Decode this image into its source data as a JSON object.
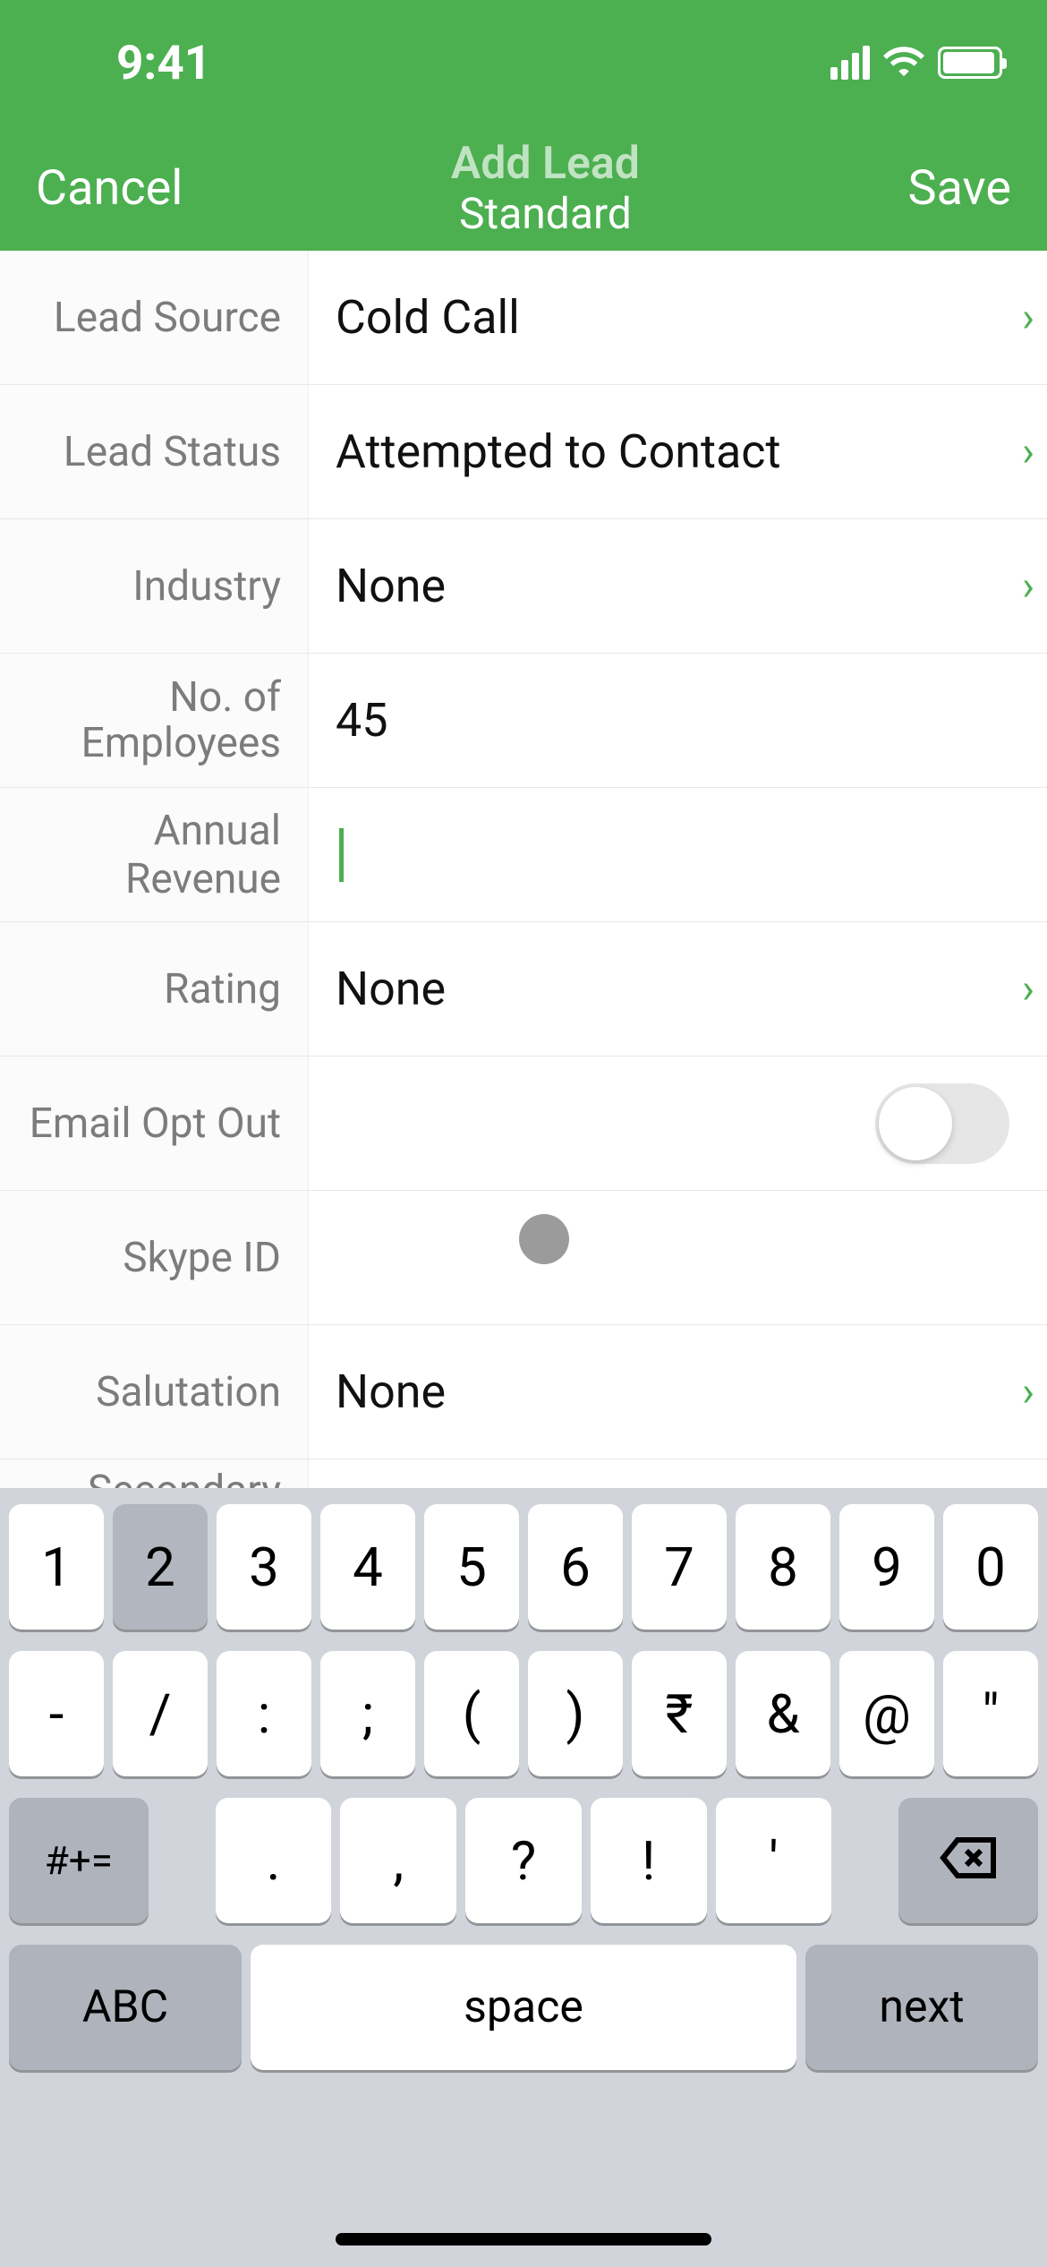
{
  "status": {
    "time": "9:41"
  },
  "nav": {
    "cancel": "Cancel",
    "save": "Save",
    "title": "Add Lead",
    "subtitle": "Standard"
  },
  "fields": {
    "lead_source": {
      "label": "Lead Source",
      "value": "Cold Call",
      "chevron": true
    },
    "lead_status": {
      "label": "Lead Status",
      "value": "Attempted to Contact",
      "chevron": true
    },
    "industry": {
      "label": "Industry",
      "value": "None",
      "chevron": true
    },
    "employees": {
      "label": "No. of Employees",
      "value": "45",
      "chevron": false
    },
    "annual_revenue": {
      "label": "Annual Revenue",
      "value": "",
      "chevron": false,
      "focused": true
    },
    "rating": {
      "label": "Rating",
      "value": "None",
      "chevron": true
    },
    "email_opt_out": {
      "label": "Email Opt Out",
      "toggle": false
    },
    "skype_id": {
      "label": "Skype ID",
      "value": "",
      "chevron": false
    },
    "salutation": {
      "label": "Salutation",
      "value": "None",
      "chevron": true
    },
    "secondary": {
      "label": "Secondary",
      "value": "",
      "chevron": false
    }
  },
  "keyboard": {
    "row1": [
      "1",
      "2",
      "3",
      "4",
      "5",
      "6",
      "7",
      "8",
      "9",
      "0"
    ],
    "row2": [
      "-",
      "/",
      ":",
      ";",
      "(",
      ")",
      "₹",
      "&",
      "@",
      "\""
    ],
    "row3_mode": "#+=",
    "row3": [
      ".",
      ",",
      "?",
      "!",
      "'"
    ],
    "row4": {
      "abc": "ABC",
      "space": "space",
      "next": "next"
    },
    "pressed_key": "2"
  }
}
